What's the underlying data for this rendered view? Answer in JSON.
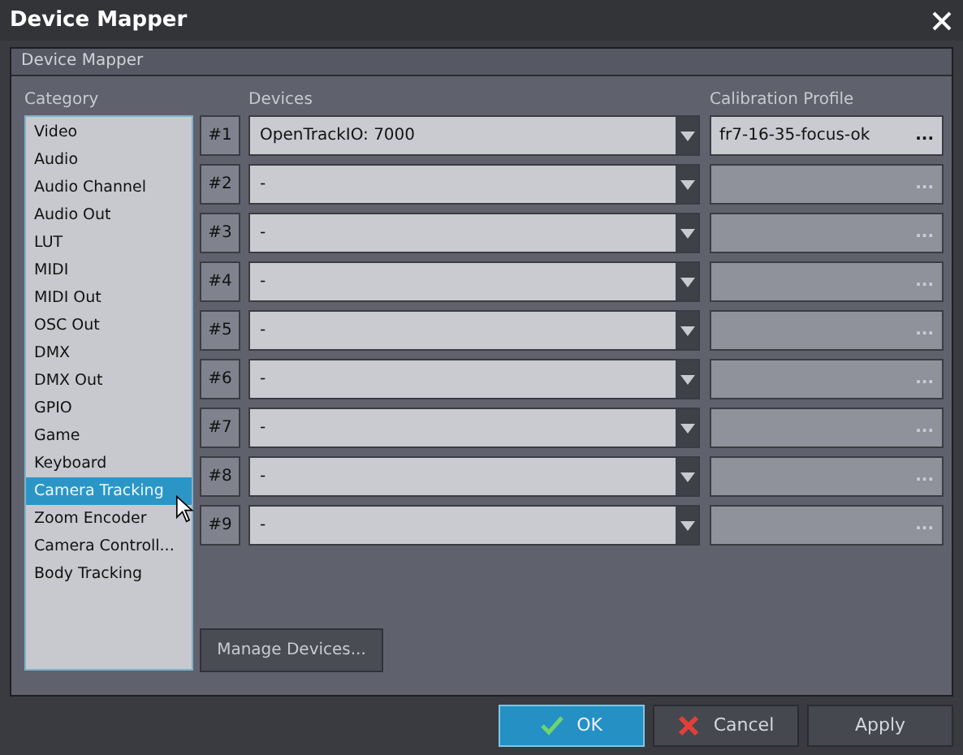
{
  "window": {
    "title": "Device Mapper"
  },
  "group": {
    "title": "Device Mapper"
  },
  "category": {
    "label": "Category",
    "items": [
      {
        "label": "Video",
        "selected": false
      },
      {
        "label": "Audio",
        "selected": false
      },
      {
        "label": "Audio Channel",
        "selected": false
      },
      {
        "label": "Audio Out",
        "selected": false
      },
      {
        "label": "LUT",
        "selected": false
      },
      {
        "label": "MIDI",
        "selected": false
      },
      {
        "label": "MIDI Out",
        "selected": false
      },
      {
        "label": "OSC Out",
        "selected": false
      },
      {
        "label": "DMX",
        "selected": false
      },
      {
        "label": "DMX Out",
        "selected": false
      },
      {
        "label": "GPIO",
        "selected": false
      },
      {
        "label": "Game",
        "selected": false
      },
      {
        "label": "Keyboard",
        "selected": false
      },
      {
        "label": "Camera Tracking",
        "selected": true
      },
      {
        "label": "Zoom Encoder",
        "selected": false
      },
      {
        "label": "Camera  Controll...",
        "selected": false
      },
      {
        "label": "Body Tracking",
        "selected": false
      }
    ]
  },
  "devices_label": "Devices",
  "profile_label": "Calibration Profile",
  "slots": [
    {
      "number": "#1",
      "device": "OpenTrackIO: 7000",
      "profile": "fr7-16-35-focus-ok",
      "profile_button": "...",
      "profile_enabled": true
    },
    {
      "number": "#2",
      "device": "-",
      "profile_button": "...",
      "profile_enabled": false
    },
    {
      "number": "#3",
      "device": "-",
      "profile_button": "...",
      "profile_enabled": false
    },
    {
      "number": "#4",
      "device": "-",
      "profile_button": "...",
      "profile_enabled": false
    },
    {
      "number": "#5",
      "device": "-",
      "profile_button": "...",
      "profile_enabled": false
    },
    {
      "number": "#6",
      "device": "-",
      "profile_button": "...",
      "profile_enabled": false
    },
    {
      "number": "#7",
      "device": "-",
      "profile_button": "...",
      "profile_enabled": false
    },
    {
      "number": "#8",
      "device": "-",
      "profile_button": "...",
      "profile_enabled": false
    },
    {
      "number": "#9",
      "device": "-",
      "profile_button": "...",
      "profile_enabled": false
    }
  ],
  "manage_button": "Manage Devices...",
  "buttons": [
    {
      "kind": "ok",
      "label": "OK",
      "selected": true
    },
    {
      "kind": "cancel",
      "label": "Cancel",
      "selected": false
    },
    {
      "kind": "plain",
      "label": "Apply",
      "selected": false
    }
  ]
}
